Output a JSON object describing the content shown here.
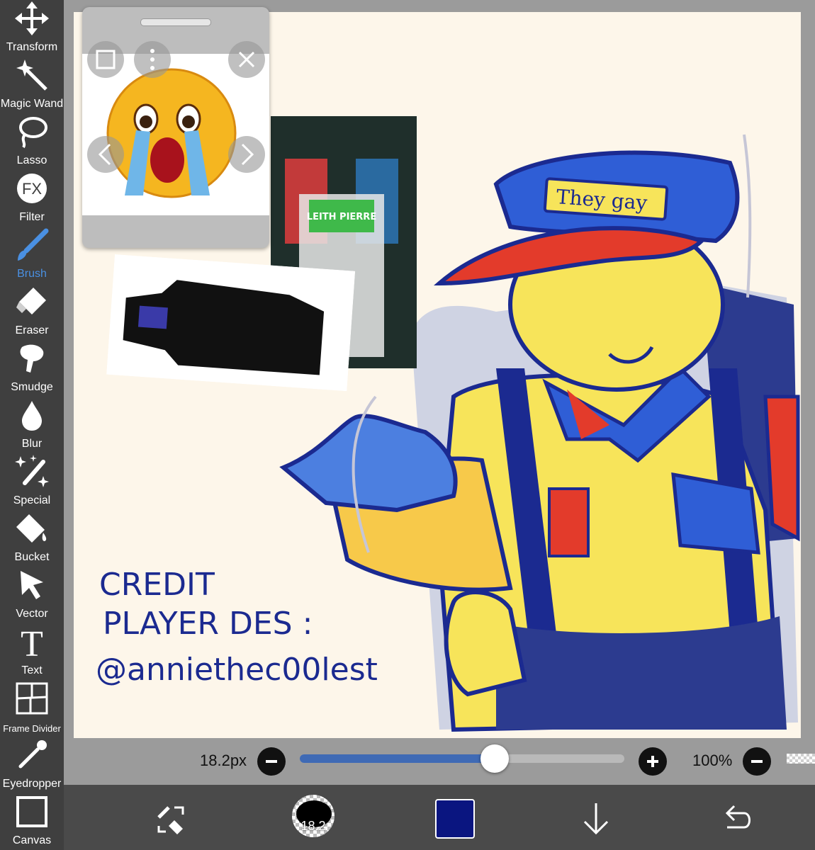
{
  "toolbar": {
    "items": [
      {
        "label": "Transform",
        "icon": "move-arrows-icon"
      },
      {
        "label": "Magic Wand",
        "icon": "magic-wand-icon"
      },
      {
        "label": "Lasso",
        "icon": "lasso-icon"
      },
      {
        "label": "Filter",
        "icon": "fx-icon"
      },
      {
        "label": "Brush",
        "icon": "brush-icon",
        "active": true
      },
      {
        "label": "Eraser",
        "icon": "eraser-icon"
      },
      {
        "label": "Smudge",
        "icon": "smudge-finger-icon"
      },
      {
        "label": "Blur",
        "icon": "droplet-icon"
      },
      {
        "label": "Special",
        "icon": "special-sparkle-pen-icon"
      },
      {
        "label": "Bucket",
        "icon": "bucket-icon"
      },
      {
        "label": "Vector",
        "icon": "vector-arrow-icon"
      },
      {
        "label": "Text",
        "icon": "text-T-icon"
      },
      {
        "label": "Frame Divider",
        "icon": "frame-divider-icon"
      },
      {
        "label": "Eyedropper",
        "icon": "eyedropper-icon"
      },
      {
        "label": "Canvas",
        "icon": "canvas-square-icon"
      }
    ],
    "active_color": "#4a90e2"
  },
  "reference_window": {
    "icons": [
      "layers-square-icon",
      "more-vertical-icon",
      "close-icon",
      "chevron-left-icon",
      "chevron-right-icon"
    ]
  },
  "artwork": {
    "cap_text": "They gay",
    "sign_text": "LEITH PIERRE",
    "credit_lines": [
      "CREDIT",
      "PLAYER DES :",
      "@anniethec00lest"
    ]
  },
  "brush_slider": {
    "size_label": "18.2px",
    "value_fraction": 0.6,
    "decrease_icon": "minus-icon",
    "increase_icon": "plus-icon"
  },
  "zoom": {
    "label": "100%",
    "decrease_icon": "minus-icon"
  },
  "bottom_bar": {
    "swap_tool_icon": "brush-eraser-swap-icon",
    "brush_size": "18.2",
    "current_color": "#0a1580",
    "download_icon": "arrow-down-icon",
    "undo_icon": "undo-icon"
  }
}
